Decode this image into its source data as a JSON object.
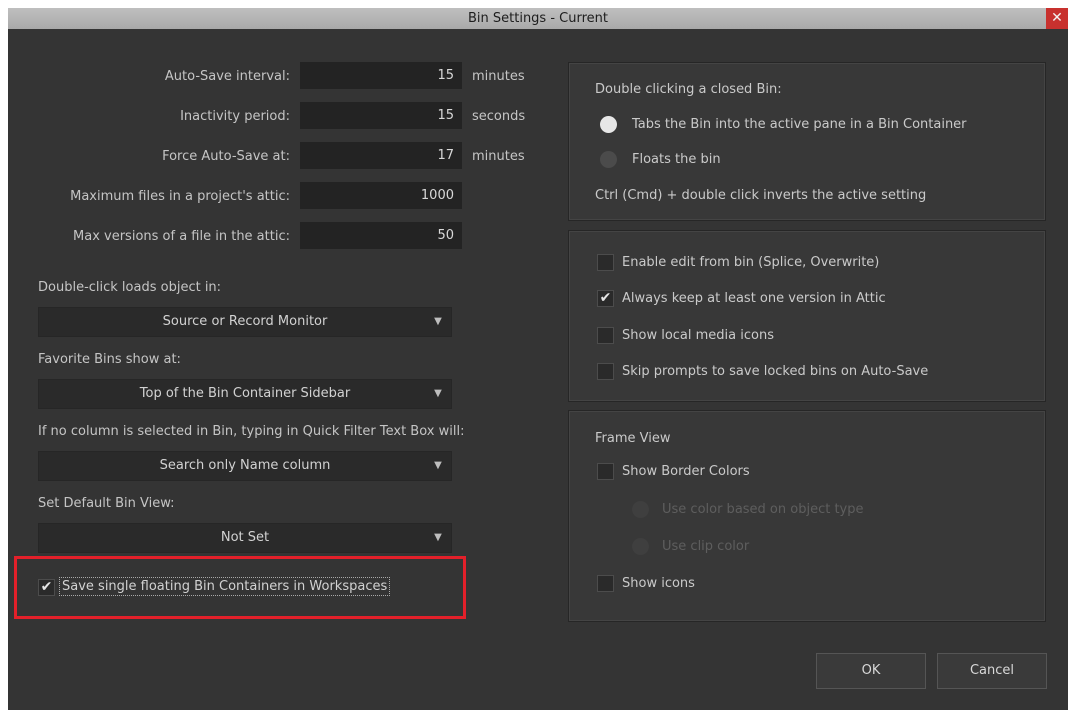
{
  "window": {
    "title": "Bin Settings - Current",
    "close_glyph": "✕"
  },
  "autosave": {
    "rows": [
      {
        "label": "Auto-Save interval:",
        "value": "15",
        "unit": "minutes"
      },
      {
        "label": "Inactivity period:",
        "value": "15",
        "unit": "seconds"
      },
      {
        "label": "Force Auto-Save at:",
        "value": "17",
        "unit": "minutes"
      },
      {
        "label": "Maximum files in a project's attic:",
        "value": "1000",
        "unit": ""
      },
      {
        "label": "Max versions of a file in the attic:",
        "value": "50",
        "unit": ""
      }
    ]
  },
  "options": {
    "double_click": {
      "label": "Double-click loads object in:",
      "value": "Source or Record Monitor"
    },
    "favorite_bins": {
      "label": "Favorite Bins show at:",
      "value": "Top of the Bin Container Sidebar"
    },
    "quick_filter": {
      "label": "If no column is selected in Bin, typing in Quick Filter Text Box will:",
      "value": "Search only Name column"
    },
    "default_view": {
      "label": "Set Default Bin View:",
      "value": "Not Set"
    },
    "dropdown_arrow": "▼"
  },
  "save_floating": {
    "label": "Save single floating Bin Containers in Workspaces",
    "checked": true,
    "check_glyph": "✔"
  },
  "closed_bin_group": {
    "title": "Double clicking a closed Bin:",
    "radios": [
      {
        "label": "Tabs the Bin into the active pane in a Bin Container",
        "selected": true
      },
      {
        "label": "Floats the bin",
        "selected": false
      }
    ],
    "hint": "Ctrl (Cmd) + double click inverts the active setting"
  },
  "checks_group": {
    "items": [
      {
        "label": "Enable edit from bin (Splice, Overwrite)",
        "checked": false,
        "glyph": ""
      },
      {
        "label": "Always keep at least one version in Attic",
        "checked": true,
        "glyph": "✔"
      },
      {
        "label": "Show local media icons",
        "checked": false,
        "glyph": ""
      },
      {
        "label": "Skip prompts to save locked bins on Auto-Save",
        "checked": false,
        "glyph": ""
      }
    ]
  },
  "frame_view": {
    "title": "Frame View",
    "show_border_colors": {
      "label": "Show Border Colors",
      "checked": false
    },
    "sub_radios": [
      {
        "label": "Use color based on object type",
        "enabled": false
      },
      {
        "label": "Use clip color",
        "enabled": false
      }
    ],
    "show_icons": {
      "label": "Show icons",
      "checked": false
    }
  },
  "buttons": {
    "ok": "OK",
    "cancel": "Cancel"
  },
  "colors": {
    "dialog_bg": "#343434",
    "highlight": "#e3202a",
    "title_bar": "#b4b4b4",
    "close": "#c8312e"
  }
}
